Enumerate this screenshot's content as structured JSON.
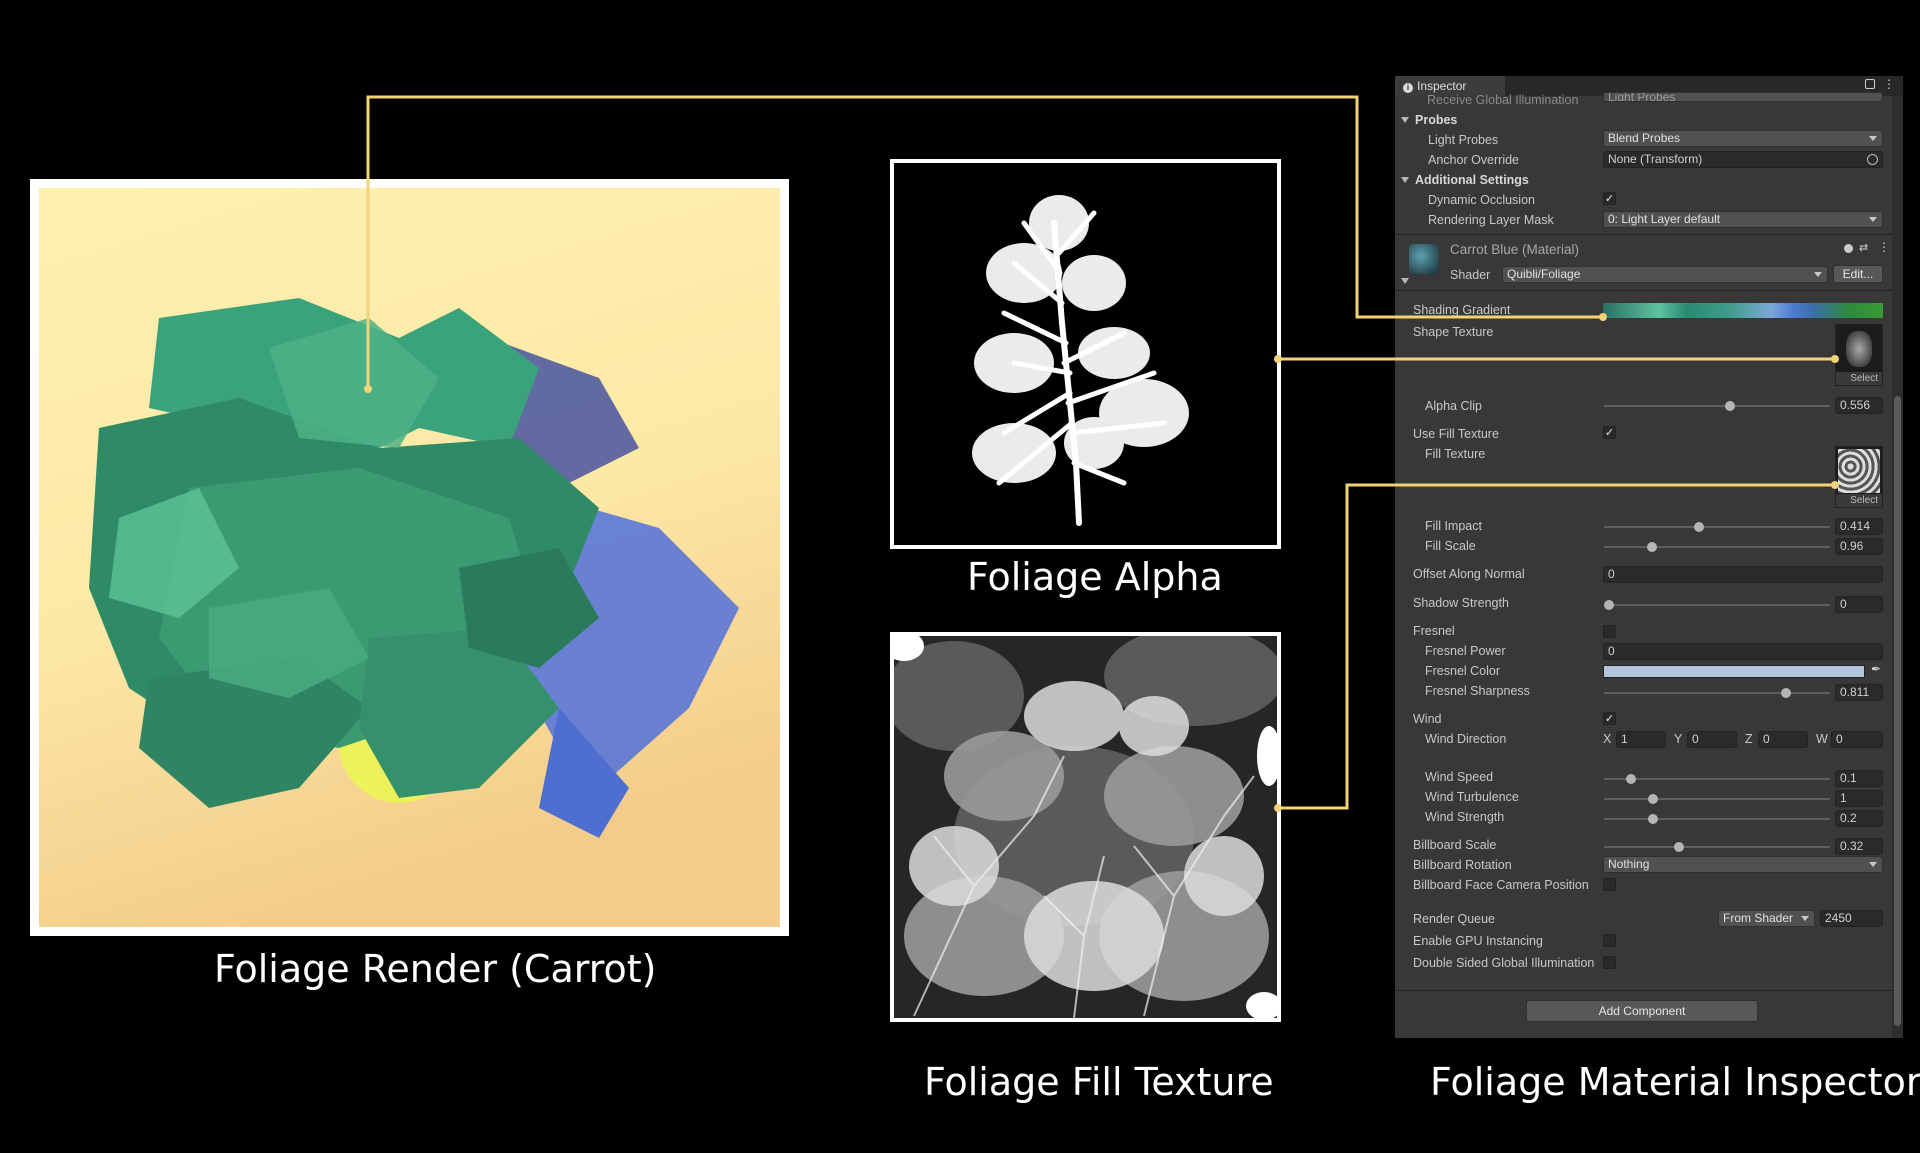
{
  "captions": {
    "render": "Foliage Render (Carrot)",
    "alpha": "Foliage Alpha",
    "fill": "Foliage Fill Texture",
    "inspector": "Foliage Material Inspector"
  },
  "colors": {
    "connector": "#f2d37a",
    "background": "#000000",
    "render_bg_top": "#fdf0b0",
    "render_bg_bottom": "#f6d58e",
    "foliage_green": "#2f8a66",
    "foliage_blue": "#5a77d8",
    "inspector_bg": "#383838"
  },
  "inspector": {
    "tab_title": "Inspector",
    "cut_row_label": "Receive Global Illumination",
    "cut_row_value": "Light Probes",
    "probes_header": "Probes",
    "light_probes_label": "Light Probes",
    "light_probes_value": "Blend Probes",
    "anchor_override_label": "Anchor Override",
    "anchor_override_value": "None (Transform)",
    "additional_header": "Additional Settings",
    "dynamic_occlusion_label": "Dynamic Occlusion",
    "rendering_layer_label": "Rendering Layer Mask",
    "rendering_layer_value": "0: Light Layer default",
    "material_name": "Carrot Blue (Material)",
    "shader_label": "Shader",
    "shader_value": "Quibli/Foliage",
    "edit_button": "Edit...",
    "shading_gradient_label": "Shading Gradient",
    "shape_texture_label": "Shape Texture",
    "select_label": "Select",
    "alpha_clip_label": "Alpha Clip",
    "alpha_clip_value": "0.556",
    "use_fill_label": "Use Fill Texture",
    "fill_texture_label": "Fill Texture",
    "fill_impact_label": "Fill Impact",
    "fill_impact_value": "0.414",
    "fill_scale_label": "Fill Scale",
    "fill_scale_value": "0.96",
    "offset_normal_label": "Offset Along Normal",
    "offset_normal_value": "0",
    "shadow_strength_label": "Shadow Strength",
    "shadow_strength_value": "0",
    "fresnel_label": "Fresnel",
    "fresnel_power_label": "Fresnel Power",
    "fresnel_power_value": "0",
    "fresnel_color_label": "Fresnel Color",
    "fresnel_color": "#b3c3dc",
    "fresnel_sharpness_label": "Fresnel Sharpness",
    "fresnel_sharpness_value": "0.811",
    "wind_label": "Wind",
    "wind_direction_label": "Wind Direction",
    "wind_x_label": "X",
    "wind_x": "1",
    "wind_y_label": "Y",
    "wind_y": "0",
    "wind_z_label": "Z",
    "wind_z": "0",
    "wind_w_label": "W",
    "wind_w": "0",
    "wind_speed_label": "Wind Speed",
    "wind_speed_value": "0.1",
    "wind_turbulence_label": "Wind Turbulence",
    "wind_turbulence_value": "1",
    "wind_strength_label": "Wind Strength",
    "wind_strength_value": "0.2",
    "billboard_scale_label": "Billboard Scale",
    "billboard_scale_value": "0.32",
    "billboard_rotation_label": "Billboard Rotation",
    "billboard_rotation_value": "Nothing",
    "billboard_face_label": "Billboard Face Camera Position",
    "render_queue_label": "Render Queue",
    "render_queue_mode": "From Shader",
    "render_queue_value": "2450",
    "gpu_instancing_label": "Enable GPU Instancing",
    "double_sided_gi_label": "Double Sided Global Illumination",
    "add_component_button": "Add Component"
  }
}
